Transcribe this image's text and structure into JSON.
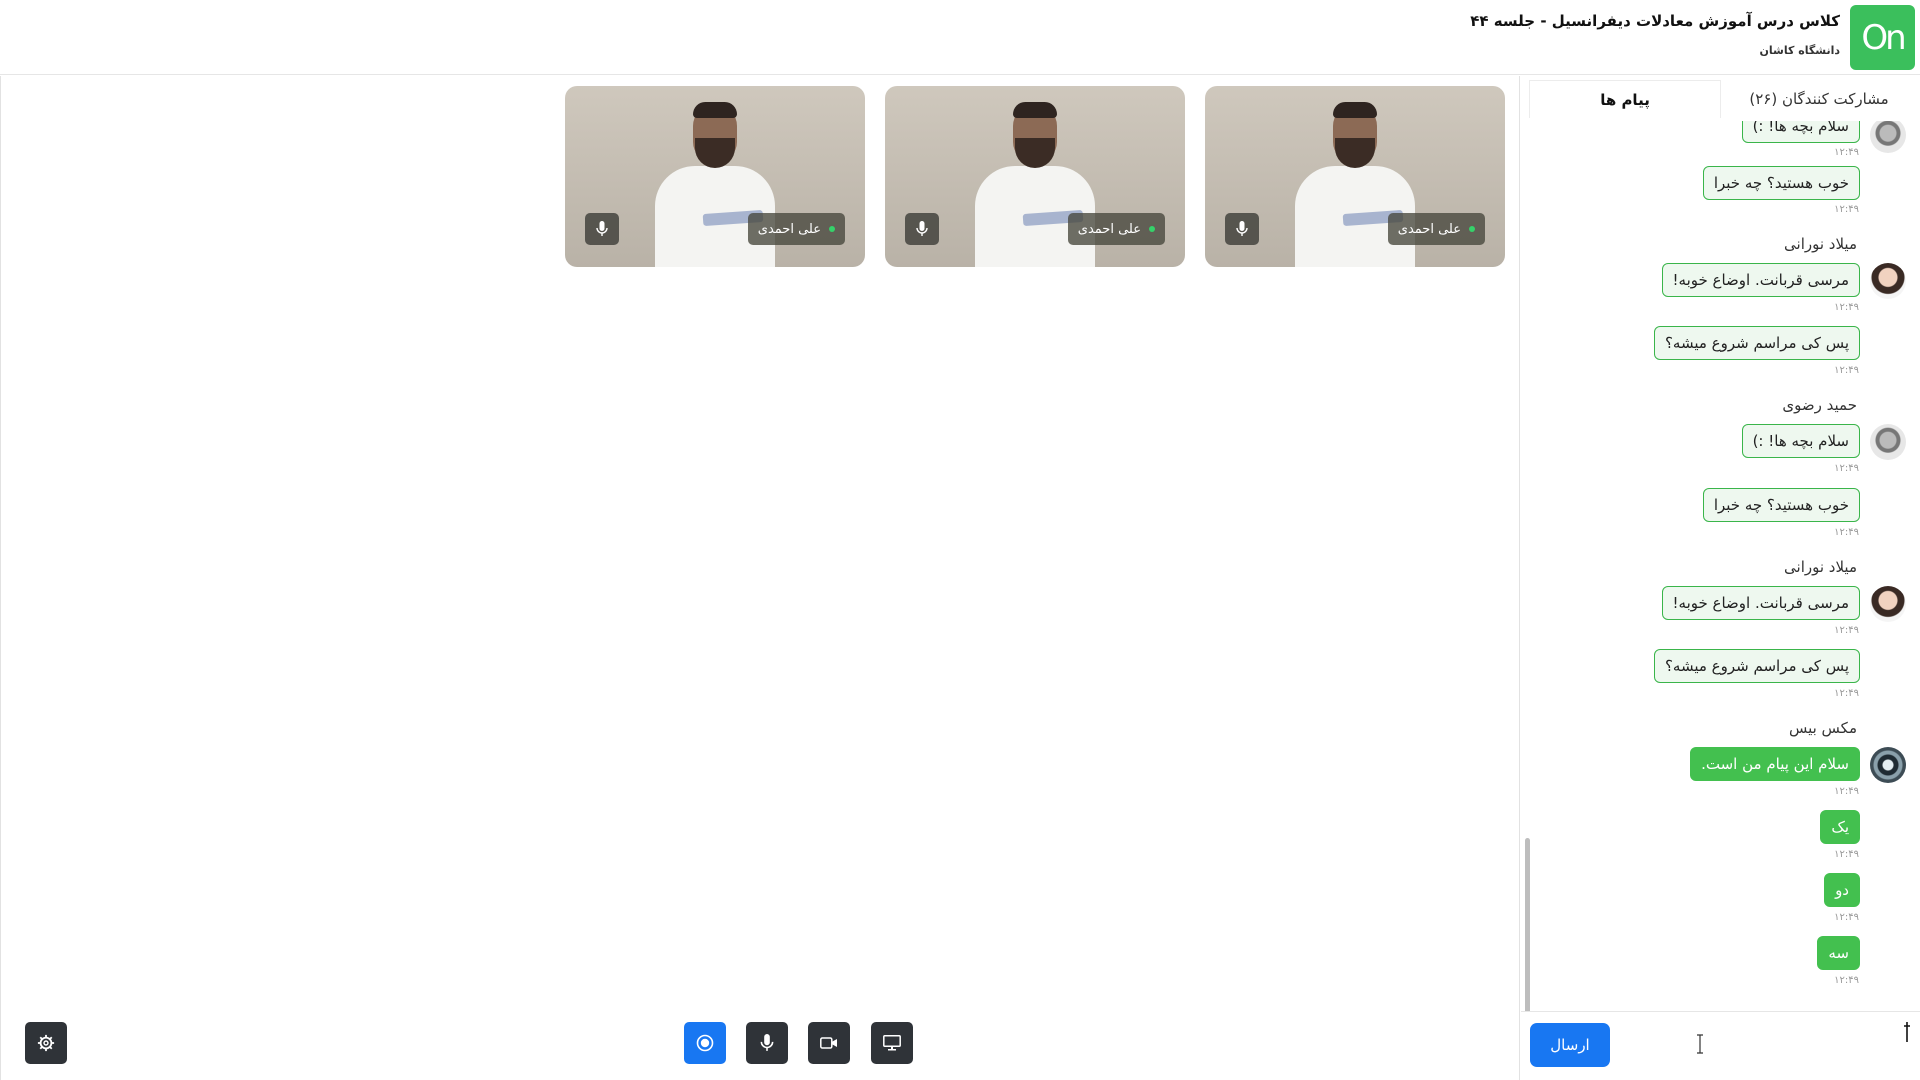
{
  "header": {
    "title": "کلاس درس آموزش معادلات دیفرانسیل - جلسه ۴۴",
    "subtitle": "دانشگاه کاشان",
    "logo_text": "On",
    "brand_color": "#3bbf5c"
  },
  "video_tiles": [
    {
      "name": "علی احمدی",
      "status": "online"
    },
    {
      "name": "علی احمدی",
      "status": "online"
    },
    {
      "name": "علی احمدی",
      "status": "online"
    }
  ],
  "toolbar": {
    "record_icon": "record-icon",
    "mic_icon": "mic-icon",
    "camera_icon": "camera-icon",
    "screen_icon": "screen-share-icon",
    "settings_icon": "gear-icon",
    "accent": "#1877f2"
  },
  "sidebar": {
    "tabs": {
      "participants": "مشارکت کنندگان (۲۶)",
      "messages": "پیام ها"
    },
    "messages": [
      {
        "text": "سلام بچه ها! :)",
        "time": "۱۲:۴۹"
      },
      {
        "text": "خوب هستید؟ چه خبرا",
        "time": "۱۲:۴۹"
      },
      {
        "sender": "میلاد نورانی"
      },
      {
        "text": "مرسی قربانت. اوضاع خوبه!",
        "time": "۱۲:۴۹"
      },
      {
        "text": "پس کی مراسم شروع میشه؟",
        "time": "۱۲:۴۹"
      },
      {
        "sender": "حمید رضوی"
      },
      {
        "text": "سلام بچه ها! :)",
        "time": "۱۲:۴۹"
      },
      {
        "text": "خوب هستید؟ چه خبرا",
        "time": "۱۲:۴۹"
      },
      {
        "sender": "میلاد نورانی"
      },
      {
        "text": "مرسی قربانت. اوضاع خوبه!",
        "time": "۱۲:۴۹"
      },
      {
        "text": "پس کی مراسم شروع میشه؟",
        "time": "۱۲:۴۹"
      },
      {
        "sender": "مکس بیس"
      },
      {
        "text": "سلام این پیام من است.",
        "time": "۱۲:۴۹"
      },
      {
        "text": "یک",
        "time": "۱۲:۴۹"
      },
      {
        "text": "دو",
        "time": "۱۲:۴۹"
      },
      {
        "text": "سه",
        "time": "۱۲:۴۹"
      }
    ],
    "composer": {
      "send_label": "ارسال",
      "input_value": "",
      "accent": "#1877f2"
    }
  }
}
